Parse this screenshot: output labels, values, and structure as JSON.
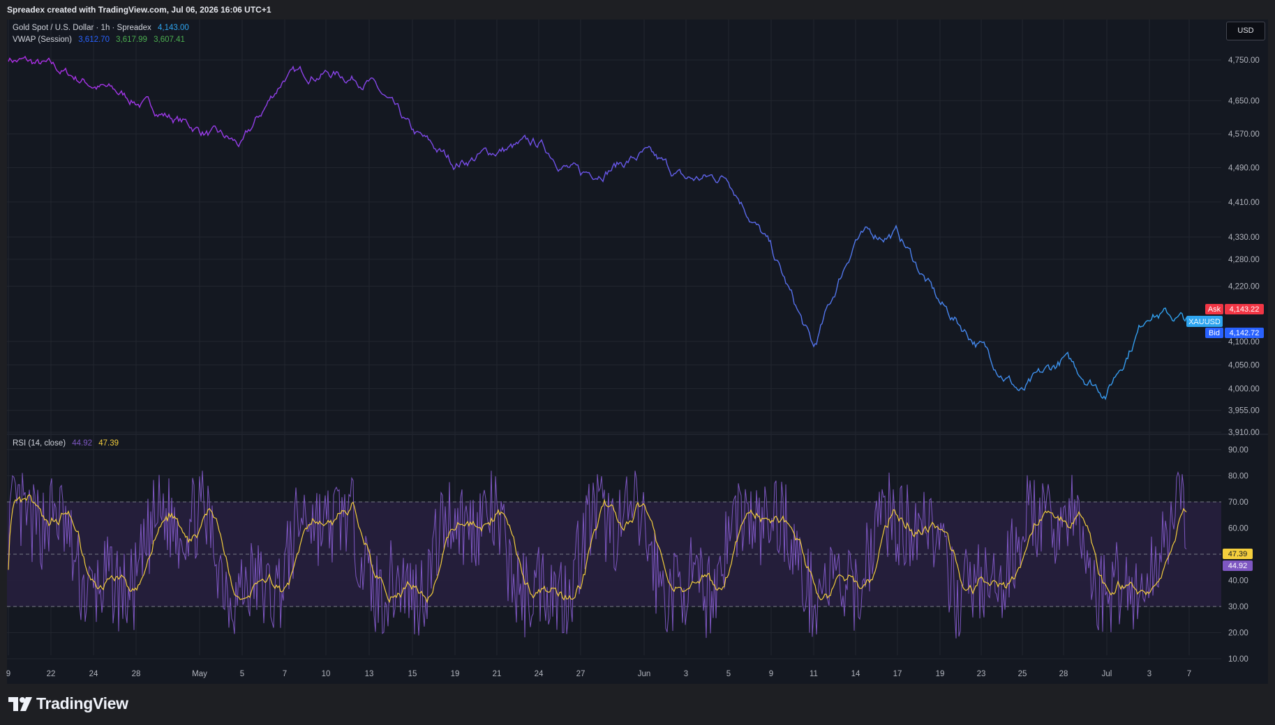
{
  "header": {
    "credit": "Spreadex created with TradingView.com, Jul 06, 2026 16:06 UTC+1"
  },
  "legend": {
    "symbol_line": "Gold Spot / U.S. Dollar · 1h · Spreadex",
    "last_price": "4,143.00",
    "vwap_label": "VWAP (Session)",
    "vwap_values": [
      "3,612.70",
      "3,617.99",
      "3,607.41"
    ],
    "rsi_label": "RSI (14, close)",
    "rsi_value": "44.92",
    "rsi_ma_value": "47.39"
  },
  "currency_button": "USD",
  "price_tags": {
    "ask_label": "Ask",
    "ask_value": "4,143.22",
    "symbol": "XAUUSD",
    "bid_label": "Bid",
    "bid_value": "4,142.72"
  },
  "rsi_tags": {
    "ma": "47.39",
    "rsi": "44.92"
  },
  "branding": {
    "logo_text": "TradingView"
  },
  "colors": {
    "background": "#141821",
    "grid": "#22262f",
    "price_start": "#b02ee8",
    "price_mid": "#6a55ea",
    "price_end": "#2ea5f0",
    "rsi_line": "#7e57c2",
    "rsi_ma": "#f5cf3d",
    "rsi_band": "#261f3d",
    "ask": "#f23645",
    "bid": "#2962ff"
  },
  "chart_data": [
    {
      "type": "line",
      "title": "Gold Spot / U.S. Dollar · 1h · Spreadex",
      "y_axis": {
        "ticks": [
          4750,
          4650,
          4570,
          4490,
          4410,
          4330,
          4280,
          4220,
          4100,
          4050,
          4000,
          3955,
          3910
        ],
        "tick_labels": [
          "4,750.00",
          "4,650.00",
          "4,570.00",
          "4,490.00",
          "4,410.00",
          "4,330.00",
          "4,280.00",
          "4,220.00",
          "4,100.00",
          "4,050.00",
          "4,000.00",
          "3,955.00",
          "3,910.00"
        ],
        "scale": "log"
      },
      "x_axis": {
        "tick_labels": [
          "9",
          "22",
          "24",
          "28",
          "May",
          "5",
          "7",
          "10",
          "13",
          "15",
          "19",
          "21",
          "24",
          "27",
          "Jun",
          "3",
          "5",
          "9",
          "11",
          "14",
          "17",
          "19",
          "23",
          "25",
          "28",
          "Jul",
          "3",
          "7"
        ]
      },
      "series": [
        {
          "name": "XAUUSD",
          "points": [
            [
              "9",
              4755
            ],
            [
              "22",
              4730
            ],
            [
              "24",
              4690
            ],
            [
              "28",
              4650
            ],
            [
              "May",
              4580
            ],
            [
              "5",
              4540
            ],
            [
              "7",
              4710
            ],
            [
              "10",
              4720
            ],
            [
              "13",
              4700
            ],
            [
              "15",
              4570
            ],
            [
              "19",
              4500
            ],
            [
              "21",
              4530
            ],
            [
              "24",
              4545
            ],
            [
              "27",
              4470
            ],
            [
              "Jun",
              4520
            ],
            [
              "3",
              4460
            ],
            [
              "5",
              4470
            ],
            [
              "9",
              4300
            ],
            [
              "11",
              4080
            ],
            [
              "14",
              4330
            ],
            [
              "17",
              4340
            ],
            [
              "19",
              4180
            ],
            [
              "23",
              4090
            ],
            [
              "25",
              3990
            ],
            [
              "28",
              4060
            ],
            [
              "Jul",
              3995
            ],
            [
              "3",
              4170
            ],
            [
              "7",
              4143
            ]
          ]
        }
      ],
      "last_price": 4143.0
    },
    {
      "type": "line",
      "title": "RSI (14, close)",
      "y_axis": {
        "ticks": [
          90,
          80,
          70,
          60,
          40,
          30,
          20,
          10
        ],
        "tick_labels": [
          "90.00",
          "80.00",
          "70.00",
          "60.00",
          "40.00",
          "30.00",
          "20.00",
          "10.00"
        ],
        "range": [
          5,
          95
        ]
      },
      "bands": {
        "upper": 70,
        "middle": 50,
        "lower": 30
      },
      "series": [
        {
          "name": "RSI",
          "last": 44.92
        },
        {
          "name": "RSI-based MA",
          "last": 47.39
        }
      ]
    }
  ]
}
